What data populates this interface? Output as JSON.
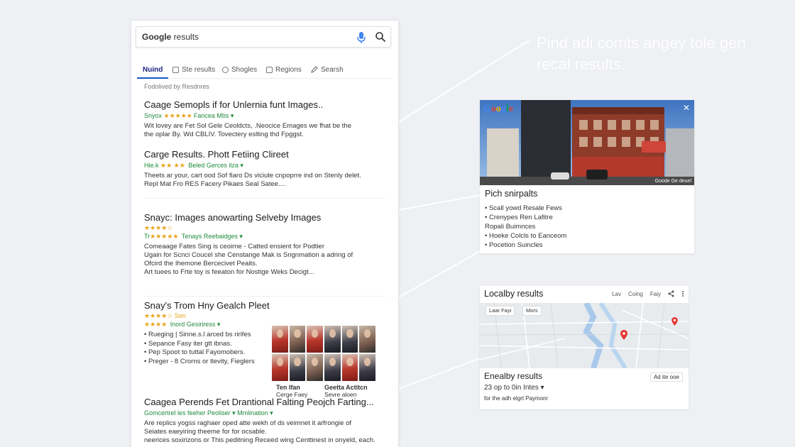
{
  "headline": "Pind adi comts angey tole gen recal results.",
  "search": {
    "brand": "Google",
    "query": " results",
    "mic_icon": "mic-icon",
    "search_icon": "search-icon"
  },
  "tabs": [
    {
      "label": "Nuind",
      "active": true,
      "icon": ""
    },
    {
      "label": "Ste results",
      "active": false,
      "icon": "square-icon"
    },
    {
      "label": "Shogles",
      "active": false,
      "icon": "circle-icon"
    },
    {
      "label": "Regions",
      "active": false,
      "icon": "square-icon"
    },
    {
      "label": "Searsh",
      "active": false,
      "icon": "pencil-icon"
    }
  ],
  "filter_label": "Fodolived by Resdnres",
  "results": [
    {
      "title": "Caage Semopls if for Unlernia funt Images..",
      "meta_stars": "★★★★★",
      "meta_prefix": "Snyox",
      "meta": "Fancea Mbs ▾",
      "desc": [
        "Wit lovey are Fet Sol Gele Ceoldcts, .Neocice Emages we fhat be the",
        "the oplar By. Wd CBLIV.  Tovectery eslting thd Fpggst."
      ]
    },
    {
      "title": "Carge Results. Phott Fetiing Clireet",
      "meta_stars": "★★ ★★",
      "meta_prefix": "Hie.k",
      "meta": "Beled Gerces ilza ▾",
      "desc": [
        "Theets ar your, cart ood Sof fiaro Ds viciute cnpoprre ind on Stenly delet.",
        "Repl Mat Fro RES Facery Pikaes Seal Satee...."
      ]
    },
    {
      "title": "Snayc: Images anowarting Selveby Images",
      "stars_line": "★★★★☆",
      "meta_stars": "★★★★★",
      "meta_prefix": "Tr",
      "meta": "Tenays Reebaidges ▾",
      "desc": [
        "Comeaage Fates Sing is ceoirne - Catted ensient for Podtier",
        "Ugain for Scnci Coucel she Censtange Mak is Sngnmation a adring of",
        "Ofcird the Ihemone Bercecivet Peaits.",
        "Art tuees to Frte toy is feeaton for Nostige Weks Decigt..."
      ]
    },
    {
      "title": "Snay's Trom Hny Gealch Pleet",
      "stars_line": "★★★★☆  Sen",
      "meta_stars": "★★★★",
      "meta_prefix": "",
      "meta": "Inord Gesiriress ▾",
      "bullets": [
        "Rueging | Sinne.s.l arced bs ririfes",
        "Sepance Fasy iter gtt ibnas.",
        "Pep Spoot to tuttal Fayomobers.",
        "Preger - 8 Crorns or tlevity, Fieglers"
      ],
      "image_captions": [
        {
          "title": "Ten Ifan",
          "sub": "Cerge Faey"
        },
        {
          "title": "Geetta Actitcn",
          "sub": "Sevre aloen"
        }
      ]
    },
    {
      "title": "Caagea Perends Fet Drantional Falting Peojch Farting...",
      "meta_prefix": "Gomcertrel",
      "meta": "les feeher Peoliser  ▾  Mmlination ▾",
      "desc": [
        "Are replics yogss raghaer oped atte wekh of ds veimnet it arfrongie of",
        "Seiates eaeyiring theeme for for ocsable.",
        "neerices soxirizons or This peditning Receed wing Centtinest in onyeld, each."
      ]
    }
  ],
  "rich_card": {
    "logo": "Google",
    "credit": "Goode Ge deuel",
    "title": "Pich snirpalts",
    "items": [
      "• Scall yowd Resale Fews",
      "• Crenypes Ren Lafitre",
      "Ropali Buimnces",
      "• Hoeke Colcls to Eanceom",
      "• Pocetion Suincles"
    ],
    "logo_colors": [
      "#4285f4",
      "#db4437",
      "#f4b400",
      "#4285f4",
      "#0f9d58",
      "#db4437"
    ]
  },
  "local_card": {
    "title": "Localby results",
    "tools": [
      "Lav",
      "Coing",
      "Faiy"
    ],
    "chips": [
      "Laar Fayi",
      "Mors"
    ],
    "subtitle": "Enealby results",
    "range": "23 op to 0in Intes ▾",
    "note": "for the adh elgrt Paymonr",
    "ad_button": "Ad ite ooe",
    "pin_color": "#e53935"
  }
}
